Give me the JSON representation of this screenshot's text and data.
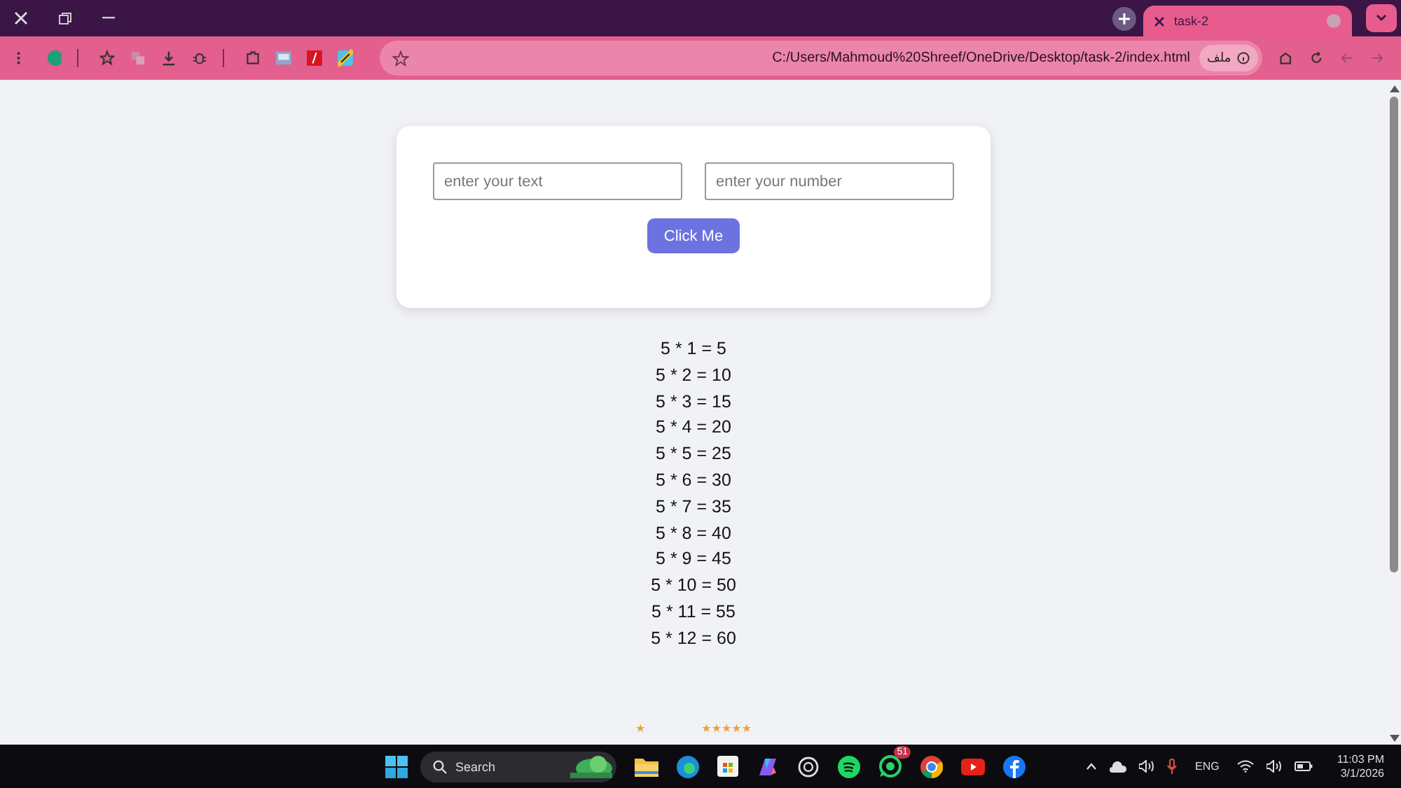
{
  "browser": {
    "tabs": [
      {
        "title": "task-2",
        "selected": true
      }
    ],
    "address_bar": {
      "url": "C:/Users/Mahmoud%20Shreef/OneDrive/Desktop/task-2/index.html",
      "chip": "ملف"
    }
  },
  "page": {
    "form": {
      "text_input": {
        "placeholder": "enter your text"
      },
      "number_input": {
        "placeholder": "enter your number"
      },
      "button": "Click Me"
    },
    "results": [
      "5 * 1 = 5",
      "5 * 2 = 10",
      "5 * 3 = 15",
      "5 * 4 = 20",
      "5 * 5 = 25",
      "5 * 6 = 30",
      "5 * 7 = 35",
      "5 * 8 = 40",
      "5 * 9 = 45",
      "5 * 10 = 50",
      "5 * 11 = 55",
      "5 * 12 = 60"
    ],
    "star_marks": [
      "★",
      "★★★★★"
    ]
  },
  "taskbar": {
    "search": {
      "placeholder": "Search"
    },
    "whatsapp_badge": "51",
    "language": "ENG",
    "time": "11:03 PM",
    "date": "3/1/2026"
  }
}
